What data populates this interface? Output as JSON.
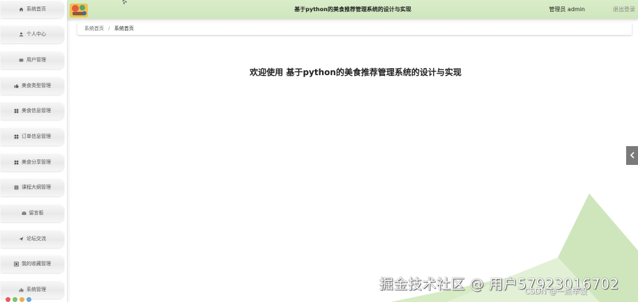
{
  "header": {
    "title": "基于python的美食推荐管理系统的设计与实现",
    "user_label": "管理员 admin",
    "logout_label": "退出登录"
  },
  "sidebar": {
    "items": [
      {
        "label": "系统首页",
        "icon": "home-icon"
      },
      {
        "label": "个人中心",
        "icon": "user-icon"
      },
      {
        "label": "用户管理",
        "icon": "users-icon"
      },
      {
        "label": "美食类型管理",
        "icon": "thumbs-up-icon"
      },
      {
        "label": "美食信息管理",
        "icon": "grid-icon"
      },
      {
        "label": "订单信息管理",
        "icon": "grid-icon"
      },
      {
        "label": "美食分享管理",
        "icon": "grid-icon"
      },
      {
        "label": "课程大纲管理",
        "icon": "list-icon"
      },
      {
        "label": "留言板",
        "icon": "message-icon"
      },
      {
        "label": "论坛交流",
        "icon": "send-icon"
      },
      {
        "label": "我的收藏管理",
        "icon": "collection-icon"
      },
      {
        "label": "系统管理",
        "icon": "chart-icon"
      }
    ]
  },
  "breadcrumb": {
    "home": "系统首页",
    "separator": "/",
    "current": "系统首页"
  },
  "main": {
    "welcome": "欢迎使用 基于python的美食推荐管理系统的设计与实现"
  },
  "watermark": {
    "text": "掘金技术社区 @ 用户5792301670​2",
    "sub": "CSDN @一点毕设"
  },
  "colors": {
    "header_bg": "#d9edc9",
    "accent_green": "#cfe6bd",
    "collapse_bg": "#7a7a7a"
  }
}
